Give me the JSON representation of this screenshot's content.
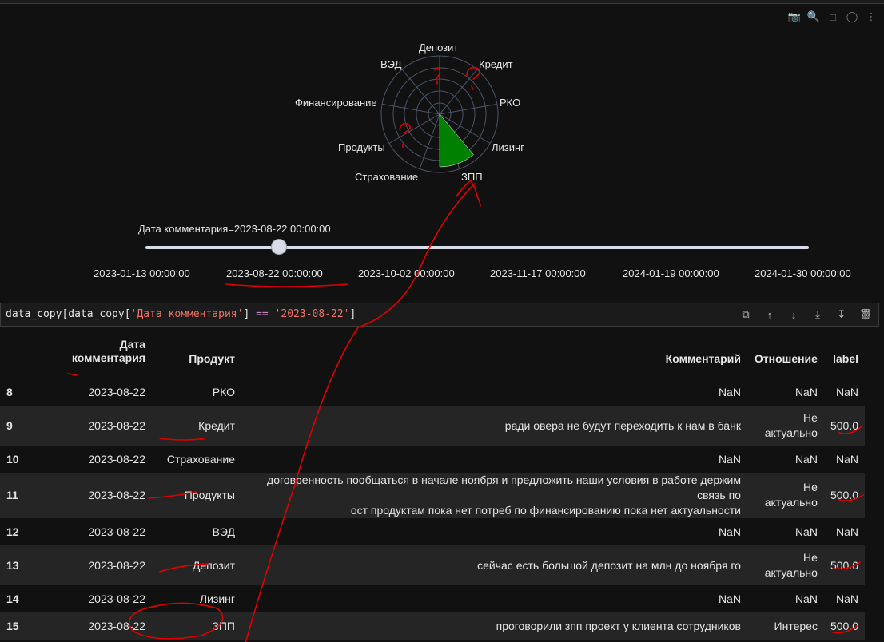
{
  "polar": {
    "labels": [
      "Депозит",
      "Кредит",
      "РКО",
      "Лизинг",
      "ЗПП",
      "Страхование",
      "Продукты",
      "Финансирование",
      "ВЭД"
    ],
    "highlight_color": "#008000"
  },
  "slider": {
    "title": "Дата комментария=2023-08-22 00:00:00",
    "current_index": 1,
    "ticks": [
      "2023-01-13 00:00:00",
      "2023-08-22 00:00:00",
      "2023-10-02 00:00:00",
      "2023-11-17 00:00:00",
      "2024-01-19 00:00:00",
      "2024-01-30 00:00:00"
    ]
  },
  "code": {
    "p1": "data_copy[data_copy[",
    "s1": "'Дата комментария'",
    "p2": "] ",
    "op": "==",
    "p3": " ",
    "s2": "'2023-08-22'",
    "p4": "]"
  },
  "table": {
    "headers": {
      "date_line1": "Дата",
      "date_line2": "комментария",
      "product": "Продукт",
      "comment": "Комментарий",
      "relation": "Отношение",
      "label": "label"
    },
    "rows": [
      {
        "idx": "8",
        "date": "2023-08-22",
        "product": "РКО",
        "comment": "NaN",
        "rel1": "NaN",
        "rel2": "",
        "label": "NaN"
      },
      {
        "idx": "9",
        "date": "2023-08-22",
        "product": "Кредит",
        "comment": "ради овера не будут переходить к нам в банк",
        "rel1": "Не",
        "rel2": "актуально",
        "label": "500.0"
      },
      {
        "idx": "10",
        "date": "2023-08-22",
        "product": "Страхование",
        "comment": "NaN",
        "rel1": "NaN",
        "rel2": "",
        "label": "NaN"
      },
      {
        "idx": "11",
        "date": "2023-08-22",
        "product": "Продукты",
        "comment": "договренность пообщаться в начале ноября и предложить наши условия в работе держим связь по",
        "comment2": "ост продуктам пока нет потреб по финансированию пока нет актуальности",
        "rel1": "Не",
        "rel2": "актуально",
        "label": "500.0"
      },
      {
        "idx": "12",
        "date": "2023-08-22",
        "product": "ВЭД",
        "comment": "NaN",
        "rel1": "NaN",
        "rel2": "",
        "label": "NaN"
      },
      {
        "idx": "13",
        "date": "2023-08-22",
        "product": "Депозит",
        "comment": "сейчас есть большой депозит на млн до ноября го",
        "rel1": "Не",
        "rel2": "актуально",
        "label": "500.0"
      },
      {
        "idx": "14",
        "date": "2023-08-22",
        "product": "Лизинг",
        "comment": "NaN",
        "rel1": "NaN",
        "rel2": "",
        "label": "NaN"
      },
      {
        "idx": "15",
        "date": "2023-08-22",
        "product": "ЗПП",
        "comment": "проговорили зпп проект у клиента сотрудников",
        "rel1": "Интерес",
        "rel2": "",
        "label": "500.0"
      }
    ]
  }
}
